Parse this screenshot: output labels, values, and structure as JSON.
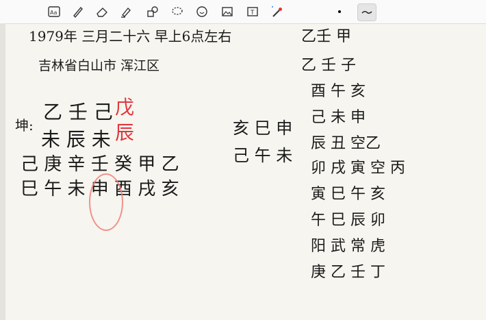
{
  "toolbar": {
    "tools": [
      {
        "name": "lasso-text-icon"
      },
      {
        "name": "pen-icon"
      },
      {
        "name": "eraser-icon"
      },
      {
        "name": "highlighter-icon"
      },
      {
        "name": "shapes-icon"
      },
      {
        "name": "lasso-icon"
      },
      {
        "name": "sticker-icon"
      },
      {
        "name": "image-icon"
      },
      {
        "name": "text-box-icon"
      },
      {
        "name": "laser-pointer-icon"
      }
    ],
    "accent_color": "#2f7bff",
    "laser_color": "#e0363c"
  },
  "note": {
    "line1": "1979年 三月二十六 早上6点左右",
    "line2": "吉林省白山市 浑江区",
    "kun_label": "坤:",
    "row_a": "乙  壬  己",
    "row_a_red": "戊",
    "row_b": "未  辰  未",
    "row_b_red": "辰",
    "row_c": "己 庚 辛 壬 癸 甲 乙",
    "row_d": "巳 午 未 申 酉 戌 亥",
    "right_col1": [
      "壬",
      "癸",
      "甲"
    ],
    "right_a": "亥  巳  申",
    "right_b": "己  午  未",
    "right_side1": "乙壬  甲",
    "right_side2": "乙  壬  子",
    "right_mid1": "酉  午  亥",
    "right_mid2": "己  未  申",
    "right_mid3": "辰  丑  空乙",
    "right_mid4": "卯  戌  寅  空  丙",
    "right_low1": "寅  巳  午  亥",
    "right_low2": "午  巳  辰  卯",
    "right_low3": "阳  武  常  虎",
    "right_low4": "庚  乙  壬  丁"
  },
  "colors": {
    "paper": "#f6f5ef",
    "ink": "#1a1a1a",
    "red_ink": "#e0363c",
    "highlight_circle": "#f07f7a"
  }
}
